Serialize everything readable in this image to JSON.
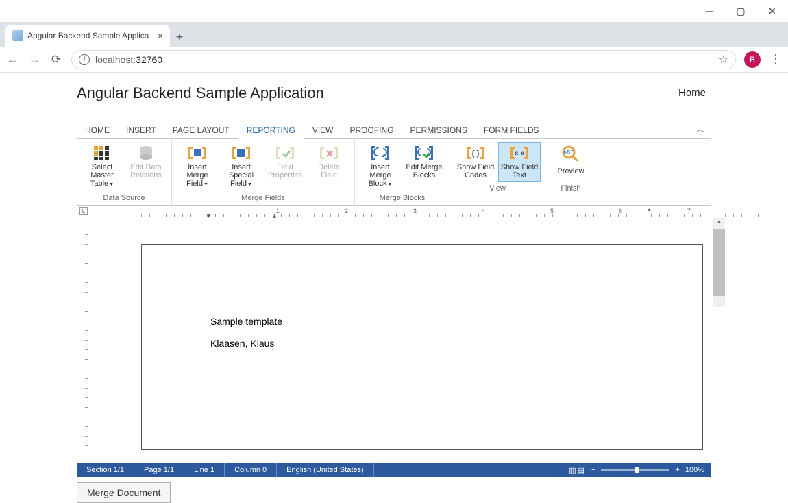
{
  "browser": {
    "tab_title": "Angular Backend Sample Applica",
    "url_host": "localhost:",
    "url_port": "32760",
    "avatar_letter": "B"
  },
  "app": {
    "title": "Angular Backend Sample Application",
    "home_link": "Home"
  },
  "ribbon": {
    "tabs": [
      "HOME",
      "INSERT",
      "PAGE LAYOUT",
      "REPORTING",
      "VIEW",
      "PROOFING",
      "PERMISSIONS",
      "FORM FIELDS"
    ],
    "selected_tab": "REPORTING",
    "groups": {
      "data_source": {
        "label": "Data Source",
        "select_master": "Select Master Table",
        "edit_relations": "Edit Data Relations"
      },
      "merge_fields": {
        "label": "Merge Fields",
        "insert_field": "Insert Merge Field",
        "insert_special": "Insert Special Field",
        "field_props": "Field Properties",
        "delete_field": "Delete Field"
      },
      "merge_blocks": {
        "label": "Merge Blocks",
        "insert_block": "Insert Merge Block",
        "edit_blocks": "Edit Merge Blocks"
      },
      "view": {
        "label": "View",
        "show_codes": "Show Field Codes",
        "show_text": "Show Field Text"
      },
      "finish": {
        "label": "Finish",
        "preview": "Preview"
      }
    }
  },
  "document": {
    "line1": "Sample template",
    "line2": "Klaasen, Klaus"
  },
  "status": {
    "section": "Section 1/1",
    "page": "Page 1/1",
    "line": "Line 1",
    "column": "Column 0",
    "language": "English (United States)",
    "zoom": "100%"
  },
  "merge_button": "Merge Document"
}
